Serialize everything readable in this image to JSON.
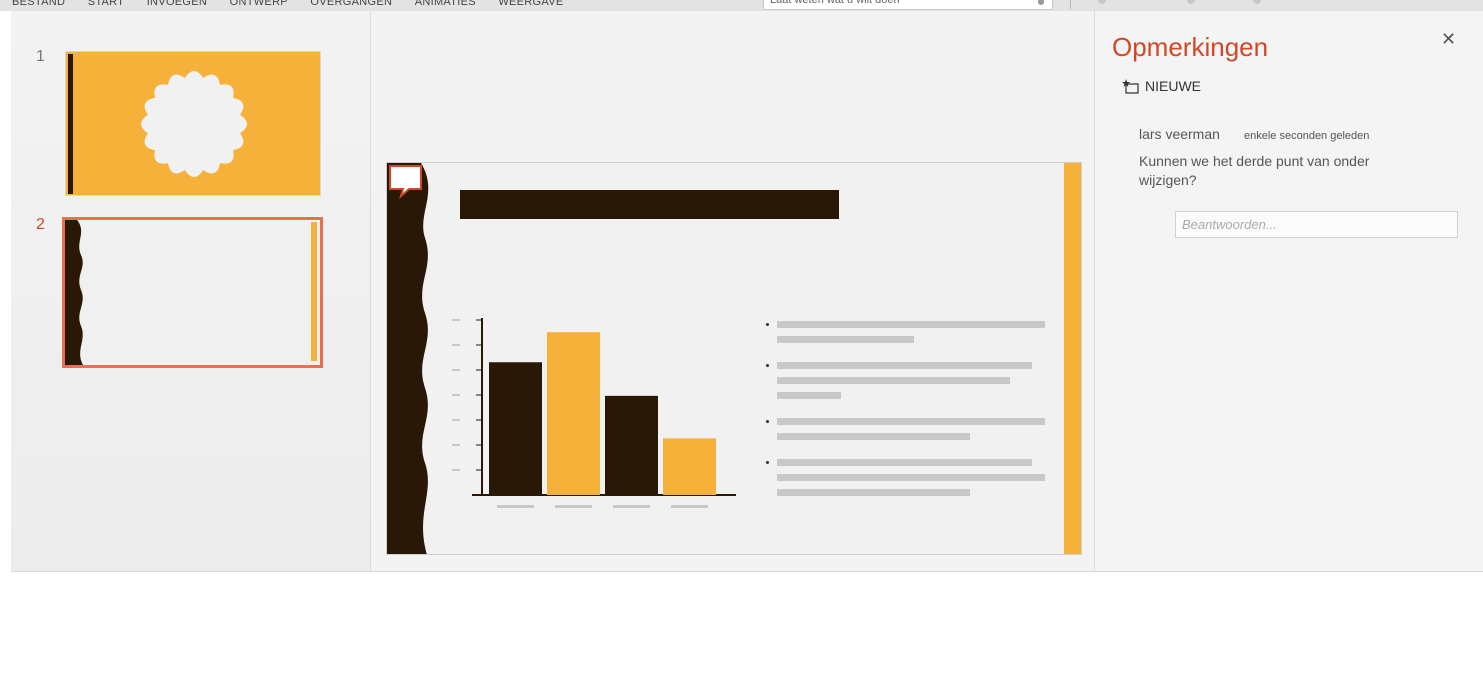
{
  "ribbon": {
    "tabs": [
      "BESTAND",
      "START",
      "INVOEGEN",
      "ONTWERP",
      "OVERGANGEN",
      "ANIMATIES",
      "WEERGAVE"
    ],
    "tell_me_placeholder": "Laat weten wat u wilt doen"
  },
  "thumbnails": {
    "items": [
      {
        "number": "1"
      },
      {
        "number": "2"
      }
    ],
    "selected": "2"
  },
  "slide": {
    "chart_data": {
      "type": "bar",
      "categories": [
        "",
        "",
        "",
        ""
      ],
      "values": [
        7.5,
        9.2,
        5.6,
        3.2
      ],
      "colors": [
        "#2a1806",
        "#f6b13a",
        "#2a1806",
        "#f6b13a"
      ],
      "title": "",
      "xlabel": "",
      "ylabel": "",
      "ylim": [
        0,
        10
      ]
    },
    "bullets": [
      {
        "lines": [
          1.0,
          0.51
        ]
      },
      {
        "lines": [
          0.95,
          0.87,
          0.24
        ]
      },
      {
        "lines": [
          1.0,
          0.72
        ]
      },
      {
        "lines": [
          0.95,
          1.0,
          0.72
        ]
      }
    ]
  },
  "comments": {
    "title": "Opmerkingen",
    "close_icon": "close-icon",
    "new_label": "NIEUWE",
    "thread": {
      "author": "lars veerman",
      "time": "enkele seconden geleden",
      "text": "Kunnen we het derde punt van onder wijzigen?"
    },
    "reply_placeholder": "Beantwoorden..."
  },
  "colors": {
    "accent": "#d24726",
    "selection": "#e8704e",
    "slide_dark": "#2a1806",
    "slide_gold": "#f6b13a"
  }
}
